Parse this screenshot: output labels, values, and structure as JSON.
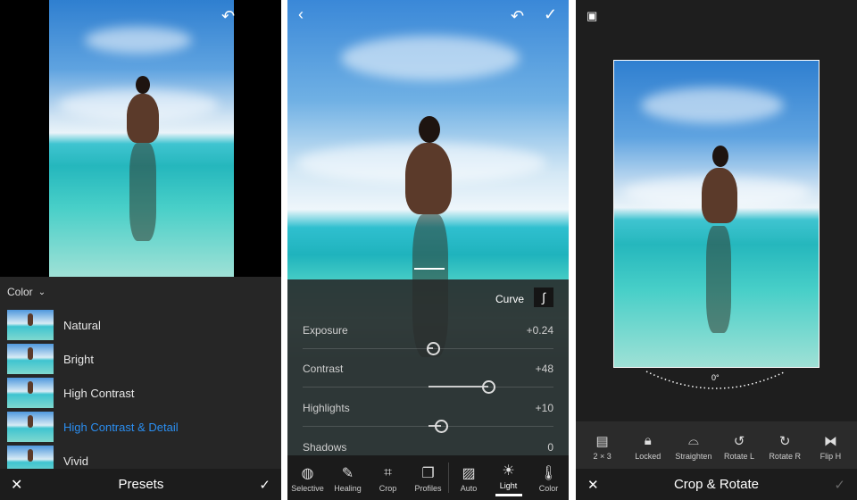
{
  "presets_panel": {
    "category": "Color",
    "items": [
      {
        "label": "Natural",
        "selected": false
      },
      {
        "label": "Bright",
        "selected": false
      },
      {
        "label": "High Contrast",
        "selected": false
      },
      {
        "label": "High Contrast & Detail",
        "selected": true
      },
      {
        "label": "Vivid",
        "selected": false
      }
    ],
    "title": "Presets",
    "accent": "#2b8ef0"
  },
  "light_panel": {
    "curve_label": "Curve",
    "sliders": [
      {
        "label": "Exposure",
        "value": "+0.24",
        "level": 0.52
      },
      {
        "label": "Contrast",
        "value": "+48",
        "level": 0.74
      },
      {
        "label": "Highlights",
        "value": "+10",
        "level": 0.55
      },
      {
        "label": "Shadows",
        "value": "0",
        "level": 0.5
      }
    ],
    "tools": [
      {
        "label": "Selective",
        "icon": "selective-brush-icon"
      },
      {
        "label": "Healing",
        "icon": "bandage-icon"
      },
      {
        "label": "Crop",
        "icon": "crop-icon"
      },
      {
        "label": "Profiles",
        "icon": "profiles-icon"
      },
      {
        "label": "Auto",
        "icon": "auto-icon"
      },
      {
        "label": "Light",
        "icon": "sun-icon",
        "active": true
      },
      {
        "label": "Color",
        "icon": "thermometer-icon"
      }
    ]
  },
  "crop_panel": {
    "angle": "0°",
    "tools": [
      {
        "label": "2 × 3",
        "icon": "aspect-icon"
      },
      {
        "label": "Locked",
        "icon": "lock-icon"
      },
      {
        "label": "Straighten",
        "icon": "straighten-icon"
      },
      {
        "label": "Rotate L",
        "icon": "rotate-left-icon"
      },
      {
        "label": "Rotate R",
        "icon": "rotate-right-icon"
      },
      {
        "label": "Flip H",
        "icon": "flip-horizontal-icon"
      }
    ],
    "title": "Crop & Rotate"
  }
}
